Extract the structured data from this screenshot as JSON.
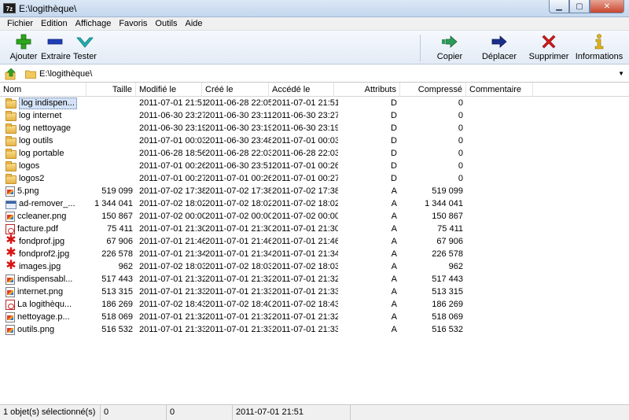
{
  "window": {
    "title": "E:\\logithèque\\",
    "minimize_glyph": "▁",
    "maximize_glyph": "▢",
    "close_glyph": "✕",
    "app_icon_text": "7z"
  },
  "menu": [
    "Fichier",
    "Edition",
    "Affichage",
    "Favoris",
    "Outils",
    "Aide"
  ],
  "toolbar": {
    "add_label": "Ajouter",
    "extract_label": "Extraire",
    "test_label": "Tester",
    "copy_label": "Copier",
    "move_label": "Déplacer",
    "delete_label": "Supprimer",
    "info_label": "Informations"
  },
  "address": {
    "path": "E:\\logithèque\\",
    "dropdown_glyph": "▼"
  },
  "columns": {
    "name": "Nom",
    "size": "Taille",
    "modified": "Modifié le",
    "created": "Créé le",
    "accessed": "Accédé le",
    "attributes": "Attributs",
    "packed": "Compressé",
    "comment": "Commentaire"
  },
  "files": [
    {
      "name": "log indispen...",
      "size": "",
      "modified": "2011-07-01 21:51",
      "created": "2011-06-28 22:05",
      "accessed": "2011-07-01 21:51",
      "attr": "D",
      "packed": "0",
      "icon": "folder"
    },
    {
      "name": "log internet",
      "size": "",
      "modified": "2011-06-30 23:27",
      "created": "2011-06-30 23:11",
      "accessed": "2011-06-30 23:27",
      "attr": "D",
      "packed": "0",
      "icon": "folder"
    },
    {
      "name": "log nettoyage",
      "size": "",
      "modified": "2011-06-30 23:19",
      "created": "2011-06-30 23:19",
      "accessed": "2011-06-30 23:19",
      "attr": "D",
      "packed": "0",
      "icon": "folder"
    },
    {
      "name": "log outils",
      "size": "",
      "modified": "2011-07-01 00:03",
      "created": "2011-06-30 23:48",
      "accessed": "2011-07-01 00:03",
      "attr": "D",
      "packed": "0",
      "icon": "folder"
    },
    {
      "name": "log portable",
      "size": "",
      "modified": "2011-06-28 18:56",
      "created": "2011-06-28 22:03",
      "accessed": "2011-06-28 22:03",
      "attr": "D",
      "packed": "0",
      "icon": "folder"
    },
    {
      "name": "logos",
      "size": "",
      "modified": "2011-07-01 00:26",
      "created": "2011-06-30 23:51",
      "accessed": "2011-07-01 00:26",
      "attr": "D",
      "packed": "0",
      "icon": "folder"
    },
    {
      "name": "logos2",
      "size": "",
      "modified": "2011-07-01 00:27",
      "created": "2011-07-01 00:26",
      "accessed": "2011-07-01 00:27",
      "attr": "D",
      "packed": "0",
      "icon": "folder"
    },
    {
      "name": "5.png",
      "size": "519 099",
      "modified": "2011-07-02 17:38",
      "created": "2011-07-02 17:38",
      "accessed": "2011-07-02 17:38",
      "attr": "A",
      "packed": "519 099",
      "icon": "png"
    },
    {
      "name": "ad-remover_...",
      "size": "1 344 041",
      "modified": "2011-07-02 18:02",
      "created": "2011-07-02 18:02",
      "accessed": "2011-07-02 18:02",
      "attr": "A",
      "packed": "1 344 041",
      "icon": "exe"
    },
    {
      "name": "ccleaner.png",
      "size": "150 867",
      "modified": "2011-07-02 00:00",
      "created": "2011-07-02 00:00",
      "accessed": "2011-07-02 00:00",
      "attr": "A",
      "packed": "150 867",
      "icon": "png"
    },
    {
      "name": "facture.pdf",
      "size": "75 411",
      "modified": "2011-07-01 21:30",
      "created": "2011-07-01 21:30",
      "accessed": "2011-07-01 21:30",
      "attr": "A",
      "packed": "75 411",
      "icon": "pdf"
    },
    {
      "name": "fondprof.jpg",
      "size": "67 906",
      "modified": "2011-07-01 21:46",
      "created": "2011-07-01 21:46",
      "accessed": "2011-07-01 21:46",
      "attr": "A",
      "packed": "67 906",
      "icon": "jpg"
    },
    {
      "name": "fondprof2.jpg",
      "size": "226 578",
      "modified": "2011-07-01 21:34",
      "created": "2011-07-01 21:34",
      "accessed": "2011-07-01 21:34",
      "attr": "A",
      "packed": "226 578",
      "icon": "jpg"
    },
    {
      "name": "images.jpg",
      "size": "962",
      "modified": "2011-07-02 18:03",
      "created": "2011-07-02 18:03",
      "accessed": "2011-07-02 18:03",
      "attr": "A",
      "packed": "962",
      "icon": "jpg"
    },
    {
      "name": "indispensabl...",
      "size": "517 443",
      "modified": "2011-07-01 21:32",
      "created": "2011-07-01 21:32",
      "accessed": "2011-07-01 21:32",
      "attr": "A",
      "packed": "517 443",
      "icon": "png"
    },
    {
      "name": "internet.png",
      "size": "513 315",
      "modified": "2011-07-01 21:33",
      "created": "2011-07-01 21:33",
      "accessed": "2011-07-01 21:33",
      "attr": "A",
      "packed": "513 315",
      "icon": "png"
    },
    {
      "name": "La logithèqu...",
      "size": "186 269",
      "modified": "2011-07-02 18:43",
      "created": "2011-07-02 18:40",
      "accessed": "2011-07-02 18:43",
      "attr": "A",
      "packed": "186 269",
      "icon": "pdf"
    },
    {
      "name": "nettoyage.p...",
      "size": "518 069",
      "modified": "2011-07-01 21:32",
      "created": "2011-07-01 21:32",
      "accessed": "2011-07-01 21:32",
      "attr": "A",
      "packed": "518 069",
      "icon": "png"
    },
    {
      "name": "outils.png",
      "size": "516 532",
      "modified": "2011-07-01 21:33",
      "created": "2011-07-01 21:33",
      "accessed": "2011-07-01 21:33",
      "attr": "A",
      "packed": "516 532",
      "icon": "png"
    }
  ],
  "status": {
    "selection": "1 objet(s) sélectionné(s)",
    "size": "0",
    "packed": "0",
    "date": "2011-07-01 21:51"
  }
}
